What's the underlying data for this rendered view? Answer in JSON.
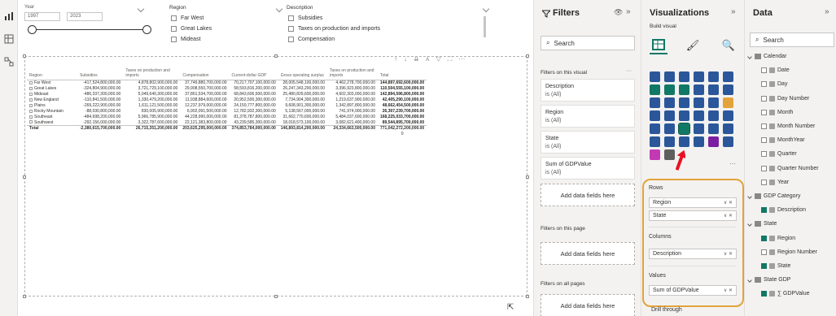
{
  "slicer_year": {
    "title": "Year",
    "from": "1997",
    "to": "2023"
  },
  "slicer_region": {
    "title": "Region",
    "options": [
      "Far West",
      "Great Lakes",
      "Mideast"
    ]
  },
  "slicer_desc": {
    "title": "Description",
    "options": [
      "Subsidies",
      "Taxes on production and imports",
      "Compensation"
    ]
  },
  "matrix": {
    "headers": [
      "Region",
      "Subsidies",
      "Taxes on production and imports",
      "Compensation",
      "Current-dollar GDP",
      "Gross operating surplus",
      "Taxes on production and imports",
      "Total"
    ],
    "rows": [
      [
        "Far West",
        "-417,524,800,000.00",
        "4,878,802,900,000.00",
        "37,749,880,700,000.00",
        "70,217,707,100,000.00",
        "28,005,548,100,000.00",
        "4,462,278,700,000.00",
        "144,897,692,600,000.00"
      ],
      [
        "Great Lakes",
        "-324,804,900,000.00",
        "3,721,729,100,000.00",
        "29,908,550,700,000.00",
        "58,593,816,200,000.00",
        "26,247,343,200,000.00",
        "3,396,923,800,000.00",
        "110,504,555,100,000.00"
      ],
      [
        "Mideast",
        "-486,337,300,000.00",
        "5,049,640,300,000.00",
        "37,861,534,700,000.00",
        "68,843,606,500,000.00",
        "25,480,829,600,000.00",
        "4,602,303,000,000.00",
        "142,894,596,800,000.00"
      ],
      [
        "New England",
        "-110,841,500,000.00",
        "1,330,479,200,000.00",
        "11,938,884,600,000.00",
        "20,952,500,300,000.00",
        "7,734,904,300,000.00",
        "1,219,637,900,000.00",
        "42,405,290,100,000.00"
      ],
      [
        "Plains",
        "-269,222,900,000.00",
        "1,611,121,500,000.00",
        "12,237,979,000,000.00",
        "24,159,777,800,000.00",
        "9,608,901,300,000.00",
        "1,342,897,800,000.00",
        "48,662,454,500,000.00"
      ],
      [
        "Rocky Mountain",
        "-88,030,800,000.00",
        "830,005,900,000.00",
        "6,902,091,500,000.00",
        "12,782,932,300,000.00",
        "5,138,567,000,000.00",
        "741,974,000,000.00",
        "26,307,239,700,000.00"
      ],
      [
        "Southeast",
        "-484,698,200,000.00",
        "5,966,785,900,000.00",
        "44,228,990,000,000.00",
        "81,378,787,800,000.00",
        "31,662,770,600,000.00",
        "5,484,037,600,000.00",
        "168,225,033,700,000.00"
      ],
      [
        "Southwest",
        "-292,156,000,000.00",
        "3,322,787,600,000.00",
        "22,121,383,800,000.00",
        "43,239,585,300,000.00",
        "18,018,573,100,000.00",
        "3,082,621,400,000.00",
        "89,544,895,700,000.00"
      ]
    ],
    "total": [
      "Total",
      "-2,380,615,700,000.00",
      "26,715,351,200,000.00",
      "203,625,295,000,000.00",
      "374,853,784,000,000.00",
      "146,893,814,200,000.00",
      "24,334,663,500,000.00",
      "771,042,272,200,000.00"
    ],
    "total_tail": "0"
  },
  "filters": {
    "title": "Filters",
    "search_placeholder": "Search",
    "on_visual": "Filters on this visual",
    "cards": [
      {
        "name": "Description",
        "value": "is (All)"
      },
      {
        "name": "Region",
        "value": "is (All)"
      },
      {
        "name": "State",
        "value": "is (All)"
      },
      {
        "name": "Sum of GDPValue",
        "value": "is (All)"
      }
    ],
    "add_fields": "Add data fields here",
    "on_page": "Filters on this page",
    "on_all": "Filters on all pages"
  },
  "visualizations": {
    "title": "Visualizations",
    "build_visual": "Build visual",
    "rows_label": "Rows",
    "rows": [
      "Region",
      "State"
    ],
    "columns_label": "Columns",
    "columns": [
      "Description"
    ],
    "values_label": "Values",
    "values": [
      "Sum of GDPValue"
    ],
    "drill": "Drill through",
    "accent": "#e3a33a"
  },
  "data_pane": {
    "title": "Data",
    "search_placeholder": "Search",
    "items": [
      {
        "label": "Calendar",
        "level": 0,
        "kind": "table"
      },
      {
        "label": "Date",
        "level": 1,
        "kind": "field",
        "checked": false
      },
      {
        "label": "Day",
        "level": 1,
        "kind": "field",
        "checked": false
      },
      {
        "label": "Day Number",
        "level": 1,
        "kind": "field",
        "checked": false
      },
      {
        "label": "Month",
        "level": 1,
        "kind": "field",
        "checked": false
      },
      {
        "label": "Month Number",
        "level": 1,
        "kind": "field",
        "checked": false
      },
      {
        "label": "MonthYear",
        "level": 1,
        "kind": "field",
        "checked": false
      },
      {
        "label": "Quarter",
        "level": 1,
        "kind": "field",
        "checked": false
      },
      {
        "label": "Quarter Number",
        "level": 1,
        "kind": "field",
        "checked": false
      },
      {
        "label": "Year",
        "level": 1,
        "kind": "field",
        "checked": false
      },
      {
        "label": "GDP Category",
        "level": 0,
        "kind": "table"
      },
      {
        "label": "Description",
        "level": 1,
        "kind": "field",
        "checked": true
      },
      {
        "label": "State",
        "level": 0,
        "kind": "table"
      },
      {
        "label": "Region",
        "level": 1,
        "kind": "field",
        "checked": true
      },
      {
        "label": "Region Number",
        "level": 1,
        "kind": "field",
        "checked": false
      },
      {
        "label": "State",
        "level": 1,
        "kind": "field",
        "checked": true
      },
      {
        "label": "State GDP",
        "level": 0,
        "kind": "table"
      },
      {
        "label": "∑ GDPValue",
        "level": 1,
        "kind": "field",
        "checked": true
      }
    ]
  }
}
